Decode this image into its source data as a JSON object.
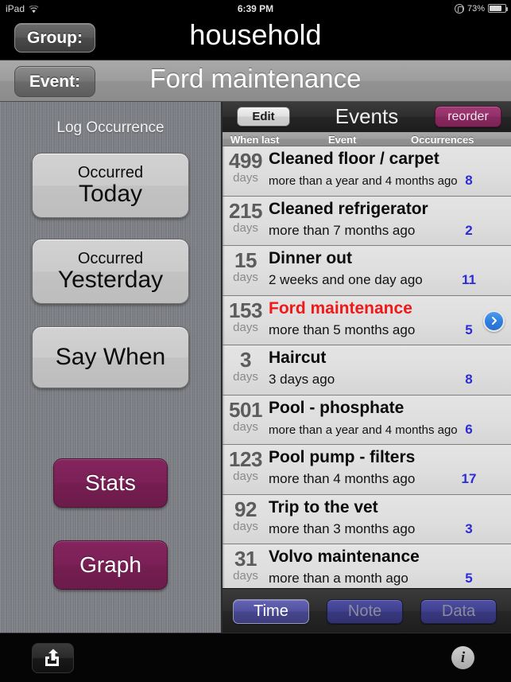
{
  "status_bar": {
    "device": "iPad",
    "wifi_icon": "wifi-icon",
    "time": "6:39 PM",
    "rotation_lock_icon": "rotation-lock-icon",
    "battery_percent": "73%",
    "battery_icon": "battery-icon"
  },
  "group_bar": {
    "group_button": "Group:",
    "group_title": "household"
  },
  "event_bar": {
    "event_button": "Event:",
    "event_title": "Ford maintenance"
  },
  "left_panel": {
    "section_label": "Log Occurrence",
    "buttons": [
      {
        "sub": "Occurred",
        "main": "Today"
      },
      {
        "sub": "Occurred",
        "main": "Yesterday"
      },
      {
        "sub": "",
        "main": "Say When"
      }
    ],
    "stats_label": "Stats",
    "graph_label": "Graph",
    "accent_color": "#7c2057",
    "panel_color": "#7d8086"
  },
  "right_panel": {
    "edit_label": "Edit",
    "title": "Events",
    "reorder_label": "reorder",
    "columns": [
      "When last",
      "Event",
      "Occurrences"
    ],
    "highlight_color": "#f01818",
    "occurrence_color": "#2b2bd8",
    "rows": [
      {
        "days": "499",
        "unit": "days",
        "name": "Cleaned floor / carpet",
        "when": "more than a year and 4 months ago",
        "when_small": true,
        "occurrences": "8",
        "selected": false
      },
      {
        "days": "215",
        "unit": "days",
        "name": "Cleaned refrigerator",
        "when": "more than 7 months ago",
        "when_small": false,
        "occurrences": "2",
        "selected": false
      },
      {
        "days": "15",
        "unit": "days",
        "name": "Dinner out",
        "when": "2 weeks and one day ago",
        "when_small": false,
        "occurrences": "11",
        "selected": false
      },
      {
        "days": "153",
        "unit": "days",
        "name": "Ford maintenance",
        "when": "more than 5 months ago",
        "when_small": false,
        "occurrences": "5",
        "selected": true
      },
      {
        "days": "3",
        "unit": "days",
        "name": "Haircut",
        "when": "3 days ago",
        "when_small": false,
        "occurrences": "8",
        "selected": false
      },
      {
        "days": "501",
        "unit": "days",
        "name": "Pool - phosphate",
        "when": "more than a year and 4 months ago",
        "when_small": true,
        "occurrences": "6",
        "selected": false
      },
      {
        "days": "123",
        "unit": "days",
        "name": "Pool pump - filters",
        "when": "more than 4 months ago",
        "when_small": false,
        "occurrences": "17",
        "selected": false
      },
      {
        "days": "92",
        "unit": "days",
        "name": "Trip to the vet",
        "when": "more than 3 months ago",
        "when_small": false,
        "occurrences": "3",
        "selected": false
      },
      {
        "days": "31",
        "unit": "days",
        "name": "Volvo maintenance",
        "when": "more than a month ago",
        "when_small": false,
        "occurrences": "5",
        "selected": false
      }
    ],
    "segmented": {
      "selected": "Time",
      "options": [
        "Time",
        "Note",
        "Data"
      ]
    }
  },
  "toolbar": {
    "share_icon": "share-export-icon",
    "info_icon": "info-icon",
    "info_glyph": "i"
  }
}
